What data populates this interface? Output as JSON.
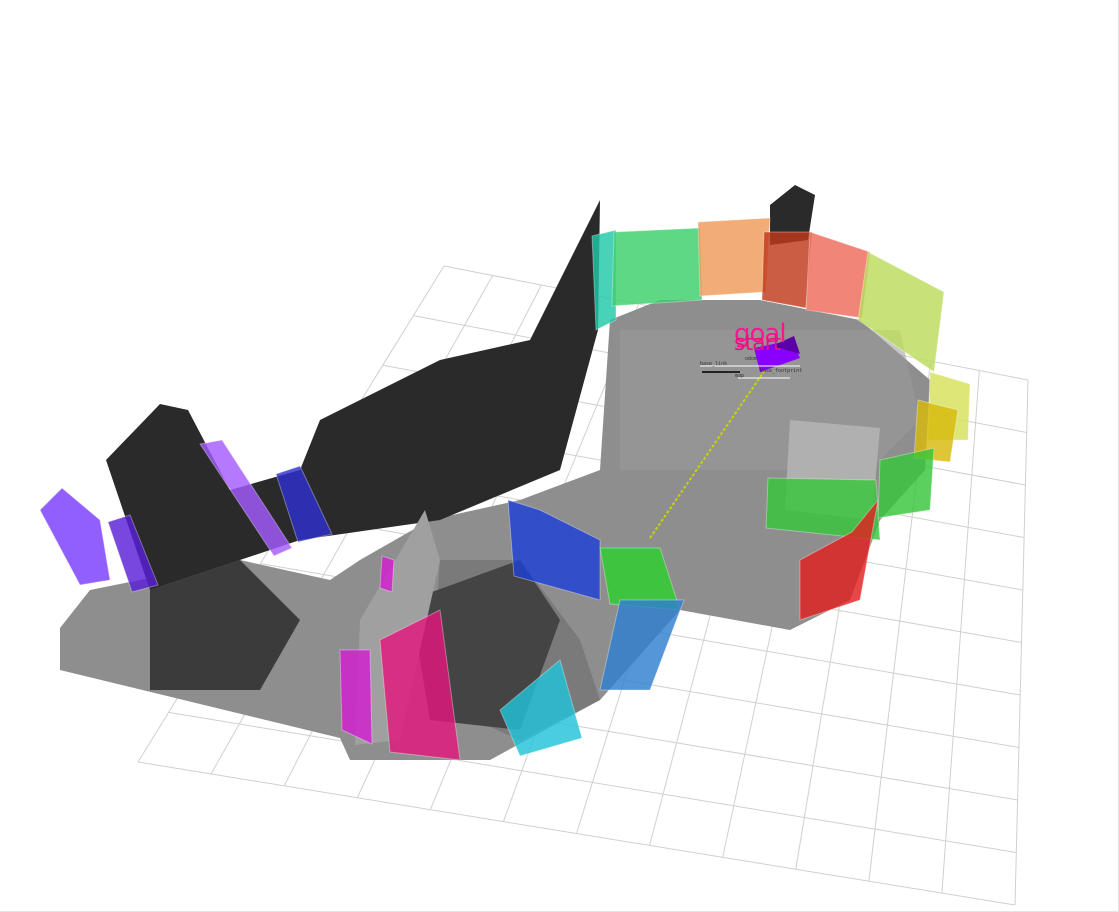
{
  "viewer": {
    "background": "#ffffff",
    "grid_color": "#d0d0d0",
    "floor_color": "#8e8e8e",
    "wall_color": "#2a2a2a",
    "path_color": "#c8d400"
  },
  "markers": {
    "goal_label": "goal",
    "start_label": "start",
    "goal_color": "#ff1493",
    "robot_color": "#8a00ff"
  },
  "tf_frames": [
    "base_link",
    "odom",
    "map",
    "base_footprint"
  ],
  "segment_colors": [
    "#7a3cff",
    "#5a1fd6",
    "#a35cff",
    "#2f2fd0",
    "#20c9a8",
    "#3cd06a",
    "#ee9a5a",
    "#c0391b",
    "#ee6b5a",
    "#b9dc5a",
    "#d8e05a",
    "#d7b90a",
    "#38c63a",
    "#e02020",
    "#1f3fd6",
    "#2ccf2c",
    "#2f7fd0",
    "#21c3d8",
    "#e0177a",
    "#d21fd0"
  ]
}
